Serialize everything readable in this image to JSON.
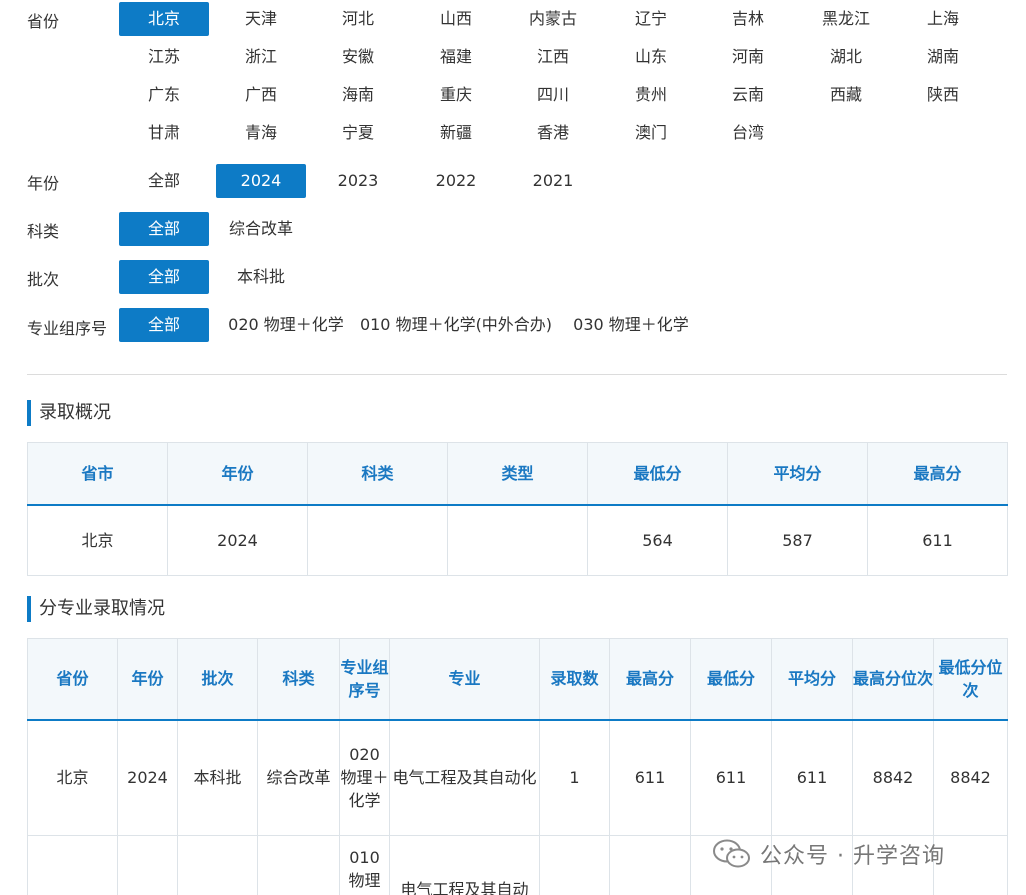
{
  "filters": {
    "province": {
      "label": "省份",
      "options": [
        "北京",
        "天津",
        "河北",
        "山西",
        "内蒙古",
        "辽宁",
        "吉林",
        "黑龙江",
        "上海",
        "江苏",
        "浙江",
        "安徽",
        "福建",
        "江西",
        "山东",
        "河南",
        "湖北",
        "湖南",
        "广东",
        "广西",
        "海南",
        "重庆",
        "四川",
        "贵州",
        "云南",
        "西藏",
        "陕西",
        "甘肃",
        "青海",
        "宁夏",
        "新疆",
        "香港",
        "澳门",
        "台湾"
      ],
      "selected": "北京"
    },
    "year": {
      "label": "年份",
      "options": [
        "全部",
        "2024",
        "2023",
        "2022",
        "2021"
      ],
      "selected": "2024"
    },
    "category": {
      "label": "科类",
      "options": [
        "全部",
        "综合改革"
      ],
      "selected": "全部"
    },
    "batch": {
      "label": "批次",
      "options": [
        "全部",
        "本科批"
      ],
      "selected": "全部"
    },
    "group": {
      "label": "专业组序号",
      "options": [
        "全部",
        "020 物理＋化学",
        "010 物理＋化学(中外合办)",
        "030 物理＋化学"
      ],
      "selected": "全部"
    }
  },
  "summary": {
    "title": "录取概况",
    "headers": [
      "省市",
      "年份",
      "科类",
      "类型",
      "最低分",
      "平均分",
      "最高分"
    ],
    "rows": [
      [
        "北京",
        "2024",
        "",
        "",
        "564",
        "587",
        "611"
      ]
    ]
  },
  "detail": {
    "title": "分专业录取情况",
    "headers": [
      "省份",
      "年份",
      "批次",
      "科类",
      "专业组序号",
      "专业",
      "录取数",
      "最高分",
      "最低分",
      "平均分",
      "最高分位次",
      "最低分位次"
    ],
    "rows": [
      [
        "北京",
        "2024",
        "本科批",
        "综合改革",
        "020 物理＋化学",
        "电气工程及其自动化",
        "1",
        "611",
        "611",
        "611",
        "8842",
        "8842"
      ],
      [
        "",
        "",
        "",
        "",
        "010 物理",
        "电气工程及其自动",
        "",
        "",
        "",
        "",
        "",
        ""
      ]
    ]
  },
  "watermark": {
    "text": "公众号 · 升学咨询",
    "icon": "wechat-icon"
  },
  "colors": {
    "accent": "#0d7bc6",
    "header_text": "#1a78c2",
    "header_bg": "#f3f8fb"
  }
}
